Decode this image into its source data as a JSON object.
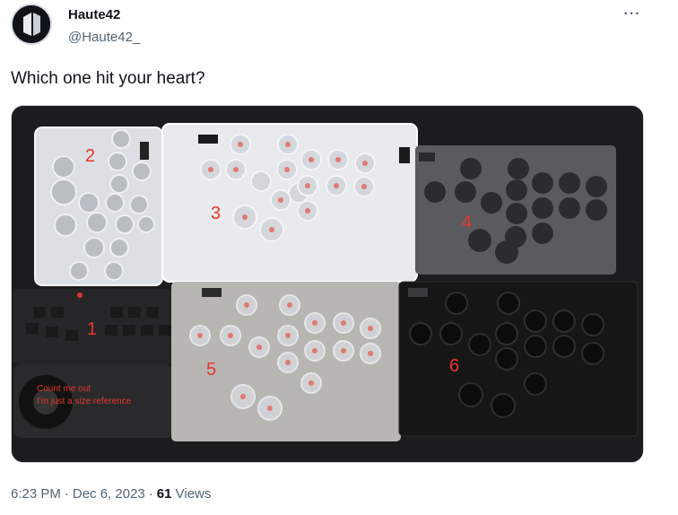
{
  "author": {
    "display_name": "Haute42",
    "handle": "@Haute42_",
    "avatar_icon": "haute42-logo-icon"
  },
  "more_icon": "more-options-icon",
  "more_label": "···",
  "tweet": {
    "text": "Which one hit your heart?"
  },
  "media": {
    "labels": {
      "box1": "1",
      "box2": "2",
      "box3": "3",
      "box4": "4",
      "box5": "5",
      "box6": "6"
    },
    "annotation_line1": "Count me out",
    "annotation_line2": "I'm just a size reference"
  },
  "meta": {
    "time": "6:23 PM",
    "date": "Dec 6, 2023",
    "separator": "·",
    "views_count": "61",
    "views_label": "Views"
  },
  "colors": {
    "label_red": "#e8352b",
    "text_secondary": "#536471",
    "text_primary": "#0f1419"
  }
}
